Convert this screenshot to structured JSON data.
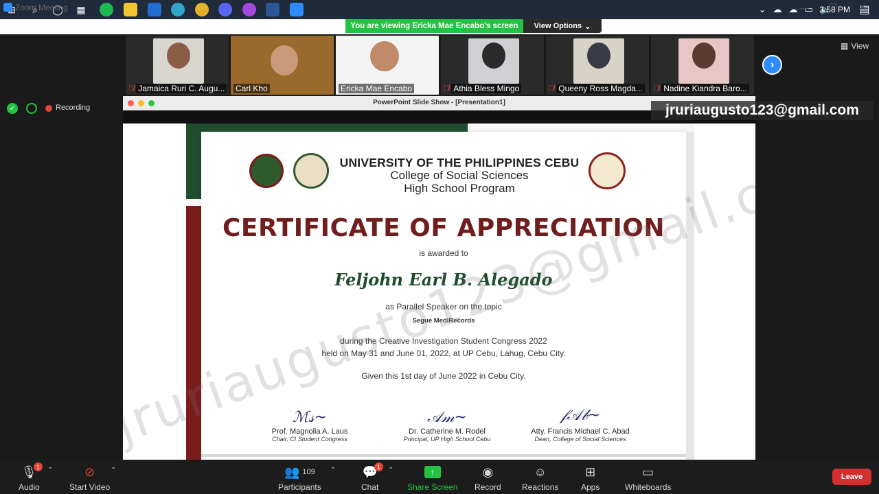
{
  "taskbar": {
    "clock": "3:58 PM",
    "apps": [
      "windows-start",
      "search",
      "cortana",
      "task-view",
      "spotify",
      "file-explorer",
      "mail",
      "edge",
      "chrome",
      "discord",
      "messenger",
      "word",
      "zoom"
    ]
  },
  "window": {
    "title": "Zoom Meeting",
    "viewing_banner": "You are viewing Ericka Mae Encabo's screen",
    "view_options": "View Options"
  },
  "participants_strip": [
    {
      "name": "Jamaica Ruri C. Augu...",
      "muted": true
    },
    {
      "name": "Carl Kho",
      "muted": false
    },
    {
      "name": "Ericka Mae Encabo",
      "muted": false,
      "active": true
    },
    {
      "name": "Athia Bless Mingo",
      "muted": true
    },
    {
      "name": "Queeny Ross Magda...",
      "muted": true
    },
    {
      "name": "Nadine Kiandra Baro...",
      "muted": true
    }
  ],
  "view_label": "View",
  "status": {
    "recording": "Recording"
  },
  "email_overlay": "jruriaugusto123@gmail.com",
  "shared_window": {
    "title": "PowerPoint Slide Show - [Presentation1]"
  },
  "certificate": {
    "university": "UNIVERSITY OF THE PHILIPPINES CEBU",
    "college": "College of Social Sciences",
    "program": "High School Program",
    "title": "CERTIFICATE OF APPRECIATION",
    "awarded_to": "is awarded to",
    "recipient": "Feljohn Earl B. Alegado",
    "role_line": "as Parallel Speaker on the topic",
    "topic": "Segue MediRecords",
    "event_line1": "during the Creative Investigation Student Congress 2022",
    "event_line2": "held on May 31 and June 01, 2022, at UP Cebu, Lahug, Cebu City.",
    "given_line": "Given this 1st day of June 2022 in Cebu City.",
    "signatories": [
      {
        "name": "Prof. Magnolia A. Laus",
        "role": "Chair, CI Student Congress"
      },
      {
        "name": "Dr. Catherine M. Rodel",
        "role": "Principal, UP High School Cebu"
      },
      {
        "name": "Atty. Francis Michael C. Abad",
        "role": "Dean, College of Social Sciences"
      }
    ]
  },
  "watermark": "jruriaugusto123@gmail.com",
  "toolbar": {
    "audio": "Audio",
    "audio_badge": "1",
    "video": "Start Video",
    "participants": "Participants",
    "participants_count": "109",
    "chat": "Chat",
    "chat_badge": "1",
    "share": "Share Screen",
    "record": "Record",
    "reactions": "Reactions",
    "apps": "Apps",
    "whiteboards": "Whiteboards",
    "leave": "Leave"
  },
  "colors": {
    "zoom_blue": "#2d8cff",
    "share_green": "#23c243",
    "leave_red": "#d22f2f",
    "cert_maroon": "#6f1d1d",
    "cert_green": "#1f4d2e"
  }
}
